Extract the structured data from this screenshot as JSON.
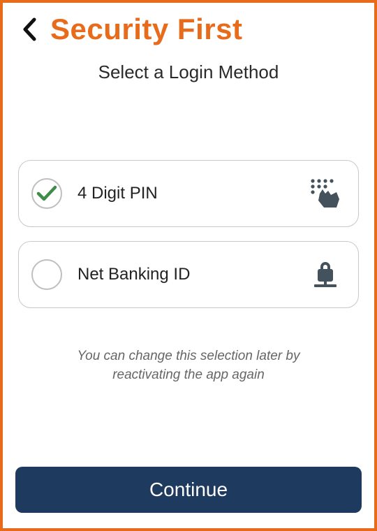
{
  "header": {
    "title": "Security First"
  },
  "subtitle": "Select a Login Method",
  "options": [
    {
      "label": "4 Digit PIN",
      "selected": true,
      "icon": "keypad-hand"
    },
    {
      "label": "Net Banking ID",
      "selected": false,
      "icon": "lock"
    }
  ],
  "hint": "You can change this selection later by reactivating the app again",
  "continue_label": "Continue",
  "colors": {
    "accent": "#e86b1c",
    "primary_button": "#1f3a5f",
    "check": "#3e8b4a"
  }
}
